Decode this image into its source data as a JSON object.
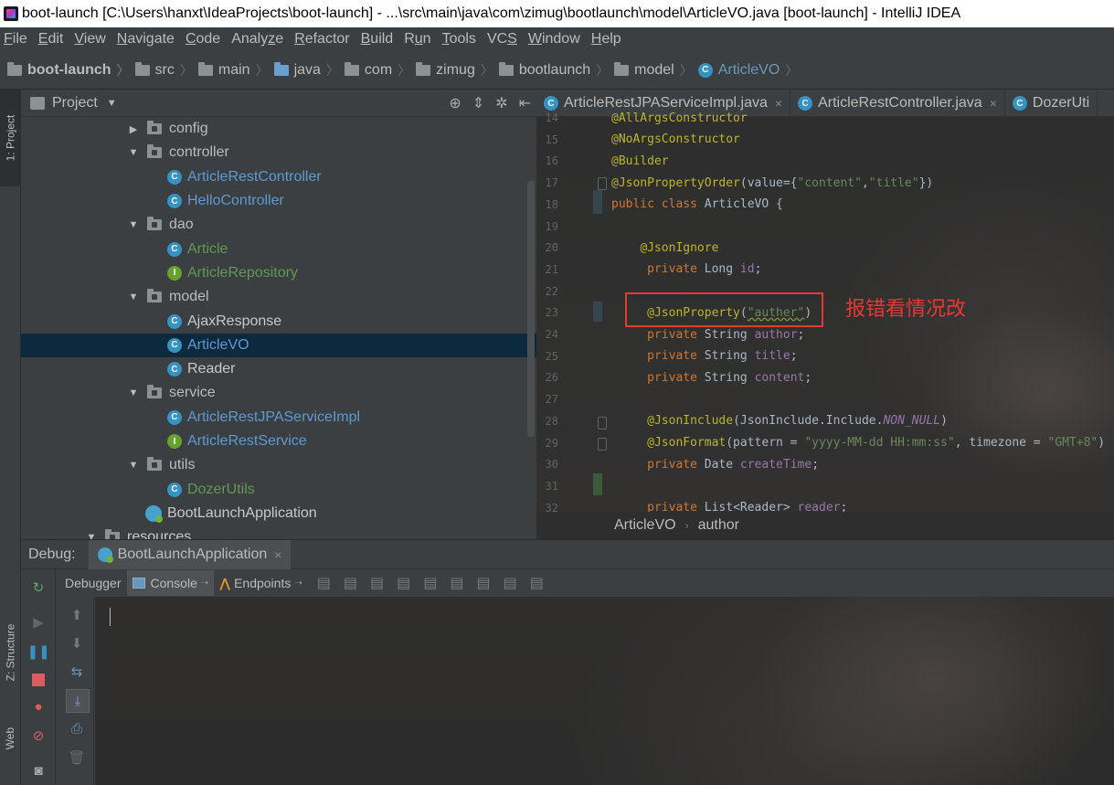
{
  "window": {
    "title": "boot-launch [C:\\Users\\hanxt\\IdeaProjects\\boot-launch] - ...\\src\\main\\java\\com\\zimug\\bootlaunch\\model\\ArticleVO.java [boot-launch] - IntelliJ IDEA"
  },
  "menu": [
    {
      "u": "F",
      "rest": "ile"
    },
    {
      "u": "E",
      "rest": "dit"
    },
    {
      "u": "V",
      "rest": "iew"
    },
    {
      "u": "N",
      "rest": "avigate"
    },
    {
      "u": "C",
      "rest": "ode"
    },
    {
      "pre": "Analy",
      "u": "z",
      "rest": "e"
    },
    {
      "u": "R",
      "rest": "efactor"
    },
    {
      "u": "B",
      "rest": "uild"
    },
    {
      "pre": "R",
      "u": "u",
      "rest": "n"
    },
    {
      "u": "T",
      "rest": "ools"
    },
    {
      "pre": "VC",
      "u": "S",
      "rest": ""
    },
    {
      "u": "W",
      "rest": "indow"
    },
    {
      "u": "H",
      "rest": "elp"
    }
  ],
  "breadcrumb": [
    "boot-launch",
    "src",
    "main",
    "java",
    "com",
    "zimug",
    "bootlaunch",
    "model",
    "ArticleVO"
  ],
  "left_strip": {
    "project_tab": "1: Project",
    "structure_tab": "Z: Structure",
    "web_tab": "Web"
  },
  "project_panel": {
    "title": "Project",
    "tree": [
      {
        "label": "config",
        "type": "folder",
        "expanded": false,
        "depth": 1
      },
      {
        "label": "controller",
        "type": "folder",
        "expanded": true,
        "depth": 1
      },
      {
        "label": "ArticleRestController",
        "type": "class",
        "depth": 2,
        "color": "blue"
      },
      {
        "label": "HelloController",
        "type": "class",
        "depth": 2,
        "color": "blue"
      },
      {
        "label": "dao",
        "type": "folder",
        "expanded": true,
        "depth": 1
      },
      {
        "label": "Article",
        "type": "class",
        "depth": 2,
        "color": "green"
      },
      {
        "label": "ArticleRepository",
        "type": "interface",
        "depth": 2,
        "color": "green"
      },
      {
        "label": "model",
        "type": "folder",
        "expanded": true,
        "depth": 1
      },
      {
        "label": "AjaxResponse",
        "type": "class",
        "depth": 2,
        "color": "white"
      },
      {
        "label": "ArticleVO",
        "type": "class",
        "depth": 2,
        "color": "blue",
        "selected": true
      },
      {
        "label": "Reader",
        "type": "class",
        "depth": 2,
        "color": "white"
      },
      {
        "label": "service",
        "type": "folder",
        "expanded": true,
        "depth": 1
      },
      {
        "label": "ArticleRestJPAServiceImpl",
        "type": "class",
        "depth": 2,
        "color": "blue"
      },
      {
        "label": "ArticleRestService",
        "type": "interface",
        "depth": 2,
        "color": "blue"
      },
      {
        "label": "utils",
        "type": "folder",
        "expanded": true,
        "depth": 1
      },
      {
        "label": "DozerUtils",
        "type": "class",
        "depth": 2,
        "color": "green"
      },
      {
        "label": "BootLaunchApplication",
        "type": "spring",
        "depth": 1,
        "color": "white"
      },
      {
        "label": "resources",
        "type": "folder",
        "expanded": true,
        "depth": 0,
        "color": "white"
      }
    ]
  },
  "editor": {
    "tabs": [
      {
        "label": "ArticleRestJPAServiceImpl.java",
        "icon": "C"
      },
      {
        "label": "ArticleRestController.java",
        "icon": "C"
      },
      {
        "label": "DozerUti",
        "icon": "C"
      }
    ],
    "lines": [
      {
        "n": "14",
        "html": "<span class='ann'>@AllArgsConstructor</span>"
      },
      {
        "n": "15",
        "html": "<span class='ann'>@NoArgsConstructor</span>"
      },
      {
        "n": "16",
        "html": "<span class='ann'>@Builder</span>"
      },
      {
        "n": "17",
        "html": "<span class='ann'>@JsonPropertyOrder</span>(value={<span class='str'>\"content\"</span>,<span class='str'>\"title\"</span>})"
      },
      {
        "n": "18",
        "html": "<span class='kw'>public class</span> ArticleVO {"
      },
      {
        "n": "19",
        "html": ""
      },
      {
        "n": "20",
        "html": "    <span class='ann'>@JsonIgnore</span>"
      },
      {
        "n": "21",
        "html": "     <span class='kw'>private</span> Long <span class='fld'>id</span>;"
      },
      {
        "n": "22",
        "html": ""
      },
      {
        "n": "23",
        "html": "     <span class='ann'>@JsonProperty</span>(<span class='str squiggle'>\"auther\"</span>)"
      },
      {
        "n": "24",
        "html": "     <span class='kw'>private</span> String <span class='fld'>author</span>;"
      },
      {
        "n": "25",
        "html": "     <span class='kw'>private</span> String <span class='fld'>title</span>;"
      },
      {
        "n": "26",
        "html": "     <span class='kw'>private</span> String <span class='fld'>content</span>;"
      },
      {
        "n": "27",
        "html": ""
      },
      {
        "n": "28",
        "html": "     <span class='ann'>@JsonInclude</span>(JsonInclude.Include.<span class='ital'>NON_NULL</span>)"
      },
      {
        "n": "29",
        "html": "     <span class='ann'>@JsonFormat</span>(pattern = <span class='str'>\"yyyy-MM-dd HH:mm:ss\"</span>, timezone = <span class='str'>\"GMT+8\"</span>)"
      },
      {
        "n": "30",
        "html": "     <span class='kw'>private</span> Date <span class='fld'>createTime</span>;"
      },
      {
        "n": "31",
        "html": ""
      },
      {
        "n": "32",
        "html": "     <span class='kw'>private</span> List&lt;Reader&gt; <span class='fld'>reader</span>;"
      }
    ],
    "annotation_note": "报错看情况改",
    "breadcrumb": [
      "ArticleVO",
      "author"
    ]
  },
  "debug": {
    "label": "Debug:",
    "config_tab": "BootLaunchApplication",
    "tabs": [
      "Debugger",
      "Console",
      "Endpoints"
    ]
  }
}
